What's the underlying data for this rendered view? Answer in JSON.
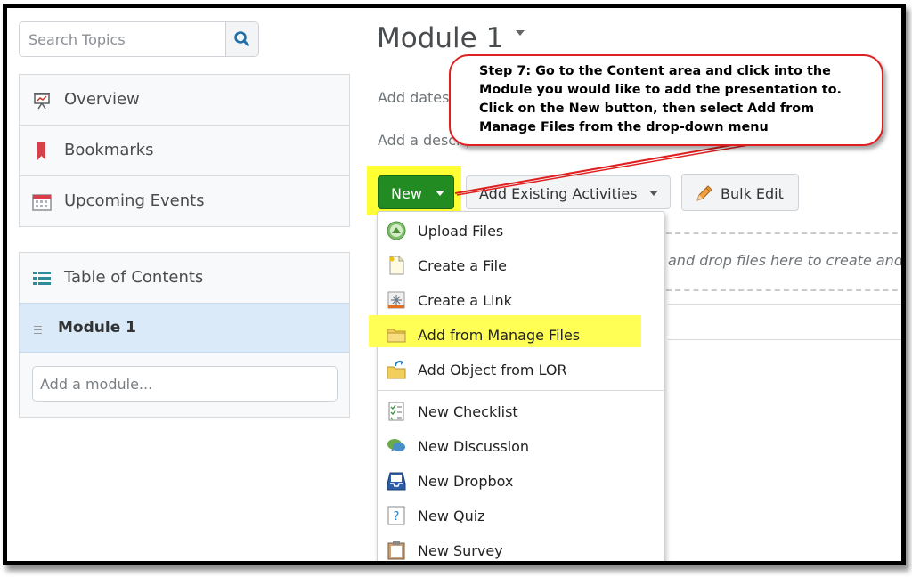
{
  "search": {
    "placeholder": "Search Topics"
  },
  "nav": {
    "items": [
      {
        "label": "Overview",
        "icon": "presentation-icon"
      },
      {
        "label": "Bookmarks",
        "icon": "bookmark-icon"
      },
      {
        "label": "Upcoming Events",
        "icon": "calendar-icon"
      }
    ],
    "toc": {
      "label": "Table of Contents",
      "icon": "list-icon",
      "module": "Module 1",
      "add_module_placeholder": "Add a module..."
    }
  },
  "main": {
    "title": "Module 1",
    "add_dates": "Add dates",
    "add_description": "Add a description...",
    "toolbar": {
      "new_label": "New",
      "add_existing_label": "Add Existing Activities",
      "bulk_edit_label": "Bulk Edit"
    },
    "dropzone_text": "and drop files here to create and u"
  },
  "new_menu": {
    "items": [
      {
        "label": "Upload Files",
        "icon": "upload-icon"
      },
      {
        "label": "Create a File",
        "icon": "file-icon"
      },
      {
        "label": "Create a Link",
        "icon": "link-icon"
      },
      {
        "label": "Add from Manage Files",
        "icon": "folder-icon",
        "highlighted": true
      },
      {
        "label": "Add Object from LOR",
        "icon": "folder-import-icon"
      },
      {
        "label": "New Checklist",
        "icon": "checklist-icon"
      },
      {
        "label": "New Discussion",
        "icon": "discussion-icon"
      },
      {
        "label": "New Dropbox",
        "icon": "dropbox-icon"
      },
      {
        "label": "New Quiz",
        "icon": "quiz-icon"
      },
      {
        "label": "New Survey",
        "icon": "survey-icon"
      }
    ]
  },
  "callout": {
    "text": "Step 7: Go to the Content area and click into the Module you would like to add the presentation to. Click on the New button, then select Add from Manage Files from the drop-down menu"
  },
  "colors": {
    "new_button": "#228b22",
    "highlight": "#ffff33",
    "callout_border": "#e02020",
    "selected_module_bg": "#daeaf8"
  }
}
